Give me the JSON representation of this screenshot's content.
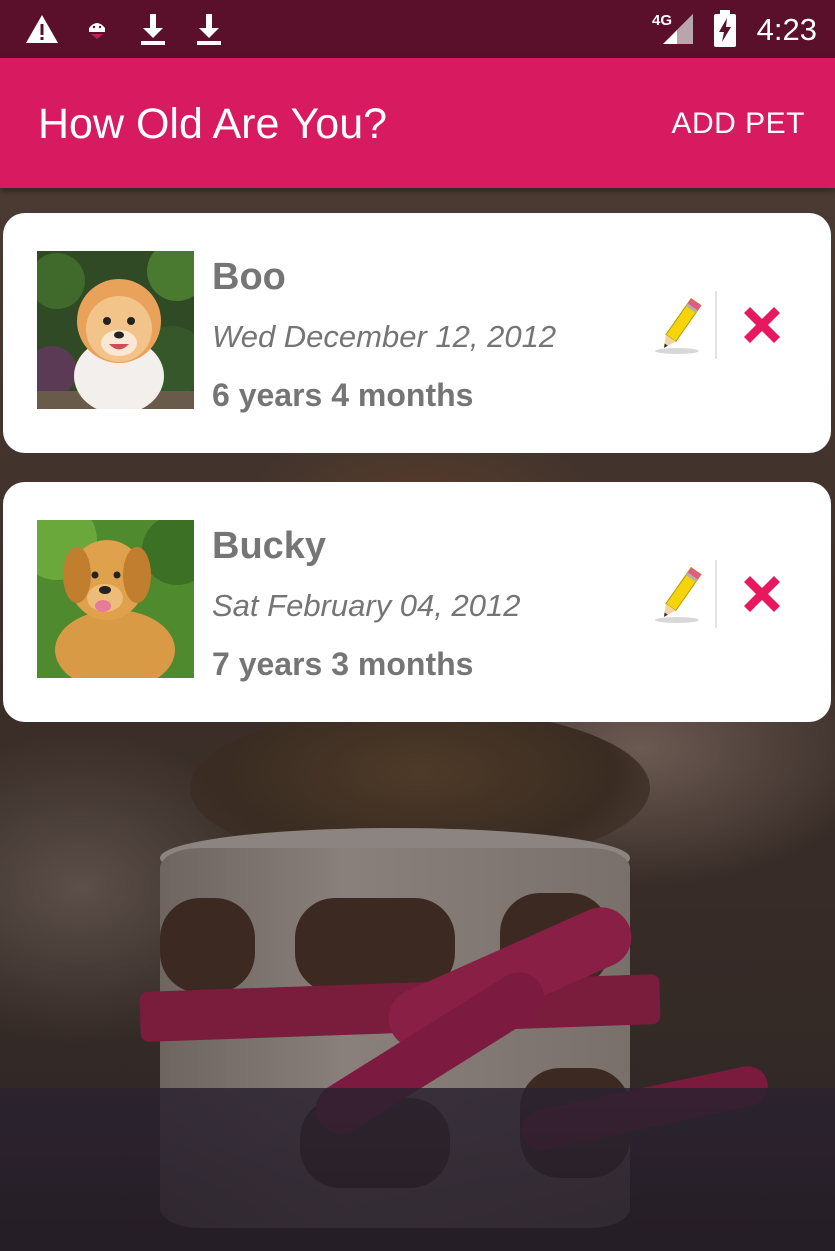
{
  "status_bar": {
    "time": "4:23",
    "network": "4G",
    "icons": [
      "warning-icon",
      "android-debug-icon",
      "download-icon",
      "download-icon",
      "signal-icon",
      "battery-charging-icon"
    ]
  },
  "app_bar": {
    "title": "How Old Are You?",
    "action_label": "ADD PET",
    "color": "#d81b60",
    "status_color": "#5a102b"
  },
  "pets": [
    {
      "name": "Boo",
      "birthdate": "Wed December 12, 2012",
      "age": "6 years 4 months",
      "edit_icon": "pencil-icon",
      "delete_icon": "close-icon"
    },
    {
      "name": "Bucky",
      "birthdate": "Sat February 04, 2012",
      "age": "7 years 3 months",
      "edit_icon": "pencil-icon",
      "delete_icon": "close-icon"
    }
  ],
  "colors": {
    "text_secondary": "#757575",
    "delete": "#e8185f",
    "pencil": "#f5d40a"
  }
}
